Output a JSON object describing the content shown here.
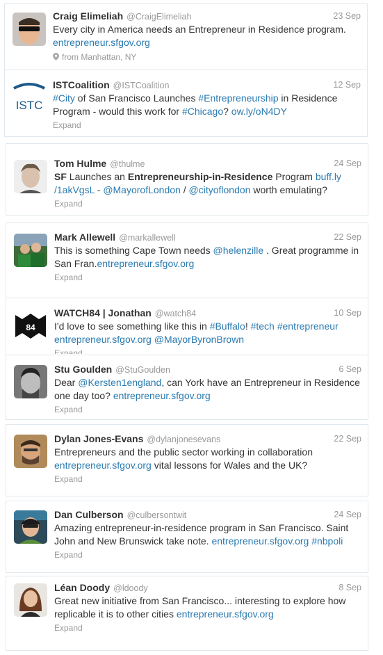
{
  "tweets": [
    {
      "name": "Craig Elimeliah",
      "handle": "@CraigElimeliah",
      "date": "23 Sep",
      "parts": [
        {
          "t": "Every city in America needs an Entrepreneur in Residence program. "
        },
        {
          "t": "entrepreneur.sfgov.org",
          "link": true
        }
      ],
      "geo": "from Manhattan, NY"
    },
    {
      "name": "ISTCoalition",
      "handle": "@ISTCoalition",
      "date": "12 Sep",
      "parts": [
        {
          "t": "#City",
          "link": true
        },
        {
          "t": " of San Francisco Launches "
        },
        {
          "t": "#Entrepreneurship",
          "link": true
        },
        {
          "t": " in Residence Program - would this work for "
        },
        {
          "t": "#Chicago",
          "link": true
        },
        {
          "t": "? "
        },
        {
          "t": "ow.ly/oN4DY",
          "link": true
        }
      ],
      "action": "Expand"
    },
    {
      "name": "Tom Hulme",
      "handle": "@thulme",
      "date": "24 Sep",
      "parts": [
        {
          "t": "SF",
          "bold": true
        },
        {
          "t": " Launches an "
        },
        {
          "t": "Entrepreneurship-in-Residence",
          "bold": true
        },
        {
          "t": " Program "
        },
        {
          "t": "buff.ly /1akVgsL",
          "link": true
        },
        {
          "t": " - "
        },
        {
          "t": "@MayorofLondon",
          "link": true
        },
        {
          "t": " / "
        },
        {
          "t": "@cityoflondon",
          "link": true
        },
        {
          "t": " worth emulating?"
        }
      ],
      "action": "Expand"
    },
    {
      "name": "Mark Allewell",
      "handle": "@markallewell",
      "date": "22 Sep",
      "parts": [
        {
          "t": "This is something Cape Town needs "
        },
        {
          "t": "@helenzille",
          "link": true
        },
        {
          "t": " . Great programme in San Fran."
        },
        {
          "t": "entrepreneur.sfgov.org",
          "link": true
        }
      ],
      "action": "Expand"
    },
    {
      "name": "WATCH84 | Jonathan",
      "handle": "@watch84",
      "date": "10 Sep",
      "parts": [
        {
          "t": "I'd love to see something like this in "
        },
        {
          "t": "#Buffalo",
          "link": true
        },
        {
          "t": "! "
        },
        {
          "t": "#tech",
          "link": true
        },
        {
          "t": " "
        },
        {
          "t": "#entrepreneur",
          "link": true
        },
        {
          "t": " "
        },
        {
          "t": "entrepreneur.sfgov.org",
          "link": true
        },
        {
          "t": " "
        },
        {
          "t": "@MayorByronBrown",
          "link": true
        }
      ],
      "action": "Expand"
    },
    {
      "name": "Stu Goulden",
      "handle": "@StuGoulden",
      "date": "6 Sep",
      "parts": [
        {
          "t": "Dear "
        },
        {
          "t": "@Kersten1england",
          "link": true
        },
        {
          "t": ", can York have an Entrepreneur in Residence one day too? "
        },
        {
          "t": "entrepreneur.sfgov.org",
          "link": true
        }
      ],
      "action": "Expand"
    },
    {
      "name": "Dylan Jones-Evans",
      "handle": "@dylanjonesevans",
      "date": "22 Sep",
      "parts": [
        {
          "t": "Entrepreneurs and the public sector working in collaboration "
        },
        {
          "t": "entrepreneur.sfgov.org",
          "link": true
        },
        {
          "t": " vital lessons for Wales and the UK?"
        }
      ],
      "action": "Expand"
    },
    {
      "name": "Dan Culberson",
      "handle": "@culbersontwit",
      "date": "24 Sep",
      "parts": [
        {
          "t": "Amazing entrepreneur-in-residence program in San Francisco. Saint John and New Brunswick take note. "
        },
        {
          "t": "entrepreneur.sfgov.org",
          "link": true
        },
        {
          "t": " "
        },
        {
          "t": "#nbpoli",
          "link": true
        }
      ],
      "action": "Expand"
    },
    {
      "name": "Léan Doody",
      "handle": "@ldoody",
      "date": "8 Sep",
      "parts": [
        {
          "t": "Great new initiative from San Francisco... interesting to explore how replicable it is to other cities "
        },
        {
          "t": "entrepreneur.sfgov.org",
          "link": true
        }
      ],
      "action": "Expand"
    }
  ],
  "icons": [
    "map-pin-icon"
  ],
  "colors": {
    "link": "#2a7ab0",
    "muted": "#999999",
    "text": "#333333"
  }
}
